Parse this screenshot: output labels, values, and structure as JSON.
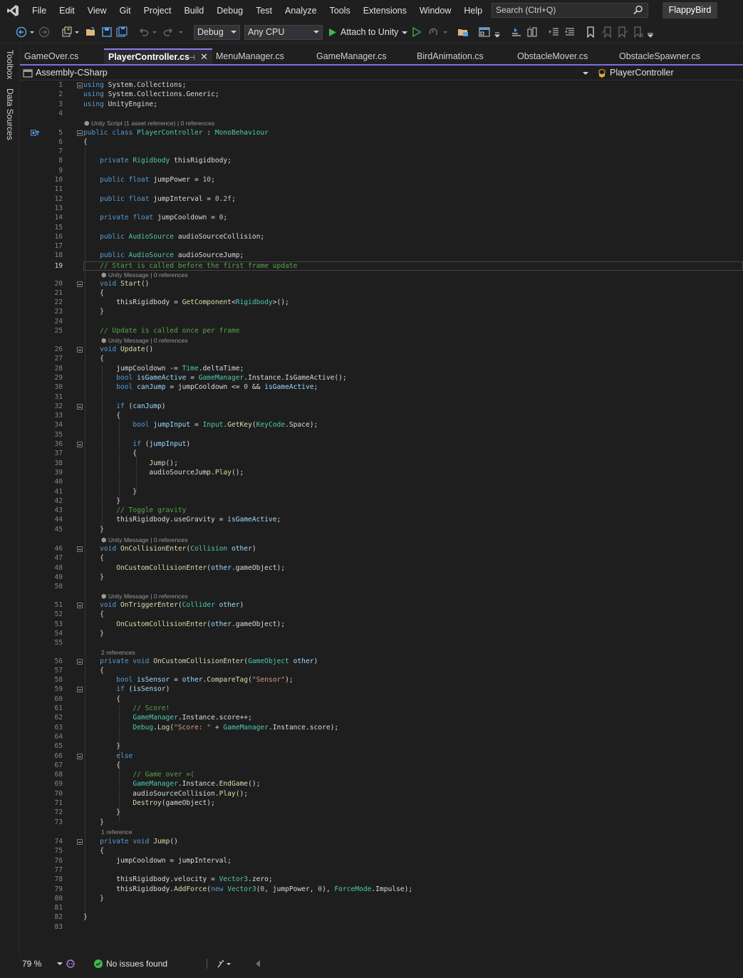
{
  "menubar": {
    "logo_icon": "visual-studio-logo-icon",
    "items": [
      "File",
      "Edit",
      "View",
      "Git",
      "Project",
      "Build",
      "Debug",
      "Test",
      "Analyze",
      "Tools",
      "Extensions",
      "Window",
      "Help"
    ],
    "search_placeholder": "Search (Ctrl+Q)",
    "solution_name": "FlappyBird"
  },
  "toolbar": {
    "configuration": "Debug",
    "platform": "Any CPU",
    "attach_label": "Attach to Unity",
    "icons": [
      "back-icon",
      "forward-icon",
      "new-project-icon",
      "open-folder-icon",
      "save-icon",
      "save-all-icon",
      "undo-icon",
      "redo-icon",
      "start-without-debugging-icon",
      "hot-reload-icon",
      "solution-explorer-icon",
      "layout-icon",
      "step-icon",
      "bookmark-icon"
    ]
  },
  "side_tabs": [
    "Toolbox",
    "Data Sources"
  ],
  "tabs": [
    {
      "label": "GameOver.cs",
      "active": false
    },
    {
      "label": "PlayerController.cs",
      "active": true
    },
    {
      "label": "MenuManager.cs",
      "active": false
    },
    {
      "label": "GameManager.cs",
      "active": false
    },
    {
      "label": "BirdAnimation.cs",
      "active": false
    },
    {
      "label": "ObstacleMover.cs",
      "active": false
    },
    {
      "label": "ObstacleSpawner.cs",
      "active": false
    }
  ],
  "navbar": {
    "project": "Assembly-CSharp",
    "type": "PlayerController"
  },
  "editor": {
    "current_line": 19,
    "codelens": {
      "class": "Unity Script (1 asset reference) | 0 references",
      "unity_message": "Unity Message | 0 references",
      "two_refs": "2 references",
      "one_ref": "1 reference"
    }
  },
  "statusbar": {
    "zoom": "79 %",
    "issues": "No issues found"
  },
  "colors": {
    "keyword": "#569cd6",
    "type": "#4ec9b0",
    "method": "#dcdcaa",
    "string": "#d69d85",
    "number": "#b5cea8",
    "comment": "#57a64a",
    "accent": "#8a7cf0"
  }
}
